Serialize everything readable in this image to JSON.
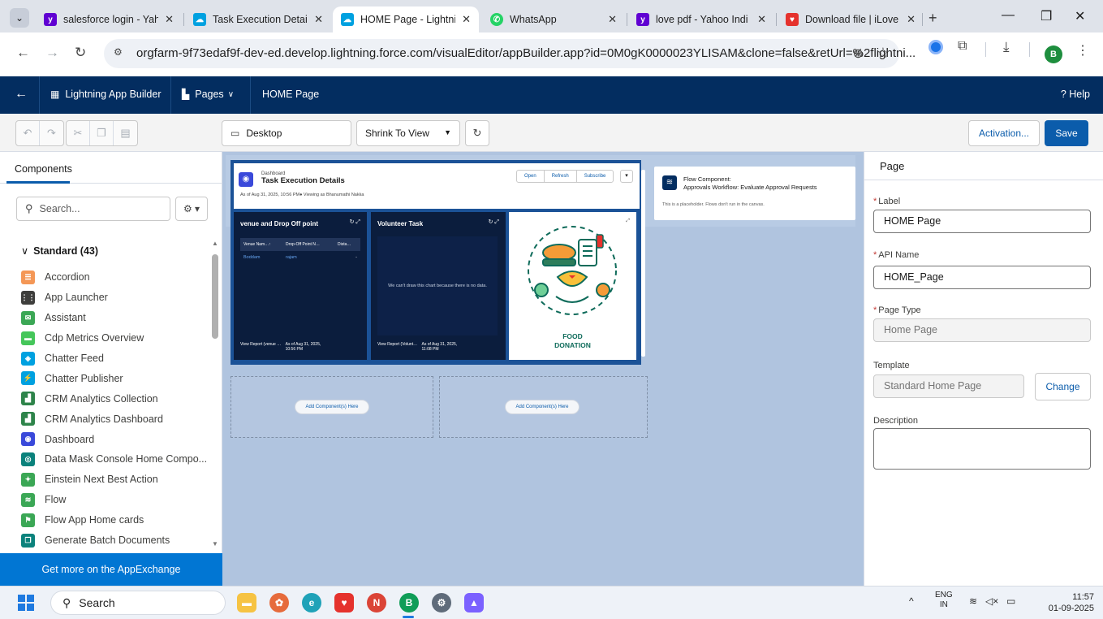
{
  "browser": {
    "tabs": [
      {
        "title": "salesforce login - Yah",
        "icon": "yahoo-icon",
        "color": "#6001d2"
      },
      {
        "title": "Task Execution Detail",
        "icon": "salesforce-icon",
        "color": "#00a1e0"
      },
      {
        "title": "HOME Page - Lightnin",
        "icon": "salesforce-icon",
        "color": "#00a1e0",
        "active": true
      },
      {
        "title": "WhatsApp",
        "icon": "whatsapp-icon",
        "color": "#25d366"
      },
      {
        "title": "love pdf - Yahoo Indi",
        "icon": "yahoo-icon",
        "color": "#6001d2"
      },
      {
        "title": "Download file | iLove",
        "icon": "ilovepdf-icon",
        "color": "#e5322d"
      }
    ],
    "url": "orgfarm-9f73edaf9f-dev-ed.develop.lightning.force.com/visualEditor/appBuilder.app?id=0M0gK0000023YLISAM&clone=false&retUrl=%2flightni...",
    "profile_initial": "B"
  },
  "header": {
    "app_name": "Lightning App Builder",
    "pages_menu": "Pages",
    "page_name": "HOME Page",
    "help": "Help"
  },
  "toolbar": {
    "device": "Desktop",
    "zoom": "Shrink To View",
    "activation": "Activation...",
    "save": "Save"
  },
  "left_panel": {
    "tab": "Components",
    "search_placeholder": "Search...",
    "section": "Standard (43)",
    "components": [
      {
        "label": "Accordion",
        "icon": "accordion-icon",
        "color": "#f49756"
      },
      {
        "label": "App Launcher",
        "icon": "app-launcher-icon",
        "color": "#3e3e3c"
      },
      {
        "label": "Assistant",
        "icon": "assistant-icon",
        "color": "#3ba755"
      },
      {
        "label": "Cdp Metrics Overview",
        "icon": "metrics-icon",
        "color": "#45c65a"
      },
      {
        "label": "Chatter Feed",
        "icon": "chatter-feed-icon",
        "color": "#00a1e0"
      },
      {
        "label": "Chatter Publisher",
        "icon": "chatter-publisher-icon",
        "color": "#00a1e0"
      },
      {
        "label": "CRM Analytics Collection",
        "icon": "analytics-icon",
        "color": "#2e844a"
      },
      {
        "label": "CRM Analytics Dashboard",
        "icon": "analytics-icon",
        "color": "#2e844a"
      },
      {
        "label": "Dashboard",
        "icon": "dashboard-icon",
        "color": "#3a49da"
      },
      {
        "label": "Data Mask Console Home Compo...",
        "icon": "data-mask-icon",
        "color": "#0b827c"
      },
      {
        "label": "Einstein Next Best Action",
        "icon": "einstein-icon",
        "color": "#3ba755"
      },
      {
        "label": "Flow",
        "icon": "flow-icon",
        "color": "#3ba755"
      },
      {
        "label": "Flow App Home cards",
        "icon": "flow-cards-icon",
        "color": "#3ba755"
      },
      {
        "label": "Generate Batch Documents",
        "icon": "documents-icon",
        "color": "#0b827c"
      }
    ],
    "appexchange": "Get more on the AppExchange"
  },
  "canvas": {
    "dashboard": {
      "kind": "Dashboard",
      "title": "Task Execution Details",
      "as_of": "As of Aug 31, 2025, 10:56 PM● Viewing as Bhanumathi Nakka",
      "buttons": [
        "Open",
        "Refresh",
        "Subscribe"
      ],
      "widget1": {
        "title": "venue and Drop Off point",
        "columns": [
          "Venue Nam…↑",
          "Drop-Off Point N…",
          "Dista…"
        ],
        "rows": [
          [
            "Boddam",
            "rajam",
            "-"
          ]
        ],
        "report_link": "View Report (venue …",
        "timestamp": "As of Aug 31, 2025, 10:56 PM"
      },
      "widget2": {
        "title": "Volunteer Task",
        "message": "We can't draw this chart because there is no data.",
        "report_link": "View Report (Volunt…",
        "timestamp": "As of Aug 31, 2025, 11:08 PM"
      },
      "food_image_text": [
        "FOOD",
        "DONATION"
      ]
    },
    "flow": {
      "line1": "Flow Component:",
      "line2": "Approvals Workflow: Evaluate Approval Requests",
      "note": "This is a placeholder. Flows don't run in the canvas."
    },
    "add_component": "Add Component(s) Here"
  },
  "right_panel": {
    "title": "Page",
    "label_label": "Label",
    "label_value": "HOME Page",
    "api_label": "API Name",
    "api_value": "HOME_Page",
    "type_label": "Page Type",
    "type_value": "Home Page",
    "template_label": "Template",
    "template_value": "Standard Home Page",
    "change": "Change",
    "description_label": "Description"
  },
  "taskbar": {
    "search": "Search",
    "lang_top": "ENG",
    "lang_bottom": "IN",
    "time": "11:57",
    "date": "01-09-2025"
  }
}
